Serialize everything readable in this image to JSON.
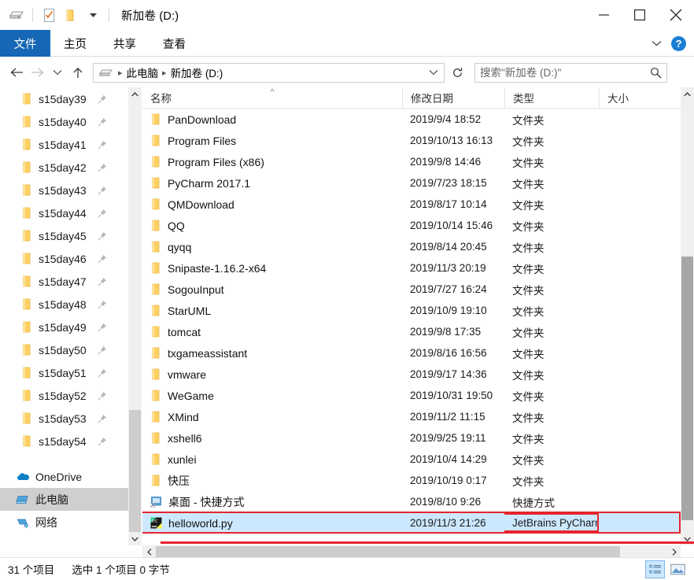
{
  "window": {
    "title": "新加卷 (D:)",
    "quick_access": [
      {
        "name": "drive-icon",
        "label": "此电脑"
      },
      {
        "name": "properties-icon",
        "label": "属性"
      },
      {
        "name": "new-folder-icon",
        "label": "新建文件夹"
      },
      {
        "name": "customize-qat-icon",
        "label": "自定义快速访问工具栏"
      }
    ],
    "controls": {
      "minimize": "最小化",
      "maximize": "最大化",
      "close": "关闭"
    }
  },
  "ribbon": {
    "tabs": [
      {
        "label": "文件",
        "active": true
      },
      {
        "label": "主页",
        "active": false
      },
      {
        "label": "共享",
        "active": false
      },
      {
        "label": "查看",
        "active": false
      }
    ],
    "collapse_label": "展开功能区",
    "help_label": "?"
  },
  "nav": {
    "back": "后退",
    "forward": "前进",
    "recent": "最近浏览的位置",
    "up": "上移一级",
    "refresh": "刷新",
    "breadcrumbs": [
      "此电脑",
      "新加卷 (D:)"
    ]
  },
  "search": {
    "placeholder": "搜索\"新加卷 (D:)\"",
    "value": ""
  },
  "sidebar": {
    "items": [
      {
        "label": "s15day39",
        "icon": "folder-icon",
        "pinned": true,
        "selected": false
      },
      {
        "label": "s15day40",
        "icon": "folder-icon",
        "pinned": true,
        "selected": false
      },
      {
        "label": "s15day41",
        "icon": "folder-icon",
        "pinned": true,
        "selected": false
      },
      {
        "label": "s15day42",
        "icon": "folder-icon",
        "pinned": true,
        "selected": false
      },
      {
        "label": "s15day43",
        "icon": "folder-icon",
        "pinned": true,
        "selected": false
      },
      {
        "label": "s15day44",
        "icon": "folder-icon",
        "pinned": true,
        "selected": false
      },
      {
        "label": "s15day45",
        "icon": "folder-icon",
        "pinned": true,
        "selected": false
      },
      {
        "label": "s15day46",
        "icon": "folder-icon",
        "pinned": true,
        "selected": false
      },
      {
        "label": "s15day47",
        "icon": "folder-icon",
        "pinned": true,
        "selected": false
      },
      {
        "label": "s15day48",
        "icon": "folder-icon",
        "pinned": true,
        "selected": false
      },
      {
        "label": "s15day49",
        "icon": "folder-icon",
        "pinned": true,
        "selected": false
      },
      {
        "label": "s15day50",
        "icon": "folder-icon",
        "pinned": true,
        "selected": false
      },
      {
        "label": "s15day51",
        "icon": "folder-icon",
        "pinned": true,
        "selected": false
      },
      {
        "label": "s15day52",
        "icon": "folder-icon",
        "pinned": true,
        "selected": false
      },
      {
        "label": "s15day53",
        "icon": "folder-icon",
        "pinned": true,
        "selected": false
      },
      {
        "label": "s15day54",
        "icon": "folder-icon",
        "pinned": true,
        "selected": false
      }
    ],
    "roots": [
      {
        "label": "OneDrive",
        "icon": "onedrive-icon",
        "selected": false
      },
      {
        "label": "此电脑",
        "icon": "this-pc-icon",
        "selected": true
      },
      {
        "label": "网络",
        "icon": "network-icon",
        "selected": false
      }
    ]
  },
  "filelist": {
    "columns": [
      {
        "key": "name",
        "label": "名称",
        "sorted": "asc"
      },
      {
        "key": "date",
        "label": "修改日期",
        "sorted": ""
      },
      {
        "key": "type",
        "label": "类型",
        "sorted": ""
      },
      {
        "key": "size",
        "label": "大小",
        "sorted": ""
      }
    ],
    "rows": [
      {
        "name": "PanDownload",
        "date": "2019/9/4 18:52",
        "type": "文件夹",
        "size": "",
        "icon": "folder-icon",
        "selected": false
      },
      {
        "name": "Program Files",
        "date": "2019/10/13 16:13",
        "type": "文件夹",
        "size": "",
        "icon": "folder-icon",
        "selected": false
      },
      {
        "name": "Program Files (x86)",
        "date": "2019/9/8 14:46",
        "type": "文件夹",
        "size": "",
        "icon": "folder-icon",
        "selected": false
      },
      {
        "name": "PyCharm 2017.1",
        "date": "2019/7/23 18:15",
        "type": "文件夹",
        "size": "",
        "icon": "folder-icon",
        "selected": false
      },
      {
        "name": "QMDownload",
        "date": "2019/8/17 10:14",
        "type": "文件夹",
        "size": "",
        "icon": "folder-icon",
        "selected": false
      },
      {
        "name": "QQ",
        "date": "2019/10/14 15:46",
        "type": "文件夹",
        "size": "",
        "icon": "folder-icon",
        "selected": false
      },
      {
        "name": "qyqq",
        "date": "2019/8/14 20:45",
        "type": "文件夹",
        "size": "",
        "icon": "folder-icon",
        "selected": false
      },
      {
        "name": "Snipaste-1.16.2-x64",
        "date": "2019/11/3 20:19",
        "type": "文件夹",
        "size": "",
        "icon": "folder-icon",
        "selected": false
      },
      {
        "name": "SogouInput",
        "date": "2019/7/27 16:24",
        "type": "文件夹",
        "size": "",
        "icon": "folder-icon",
        "selected": false
      },
      {
        "name": "StarUML",
        "date": "2019/10/9 19:10",
        "type": "文件夹",
        "size": "",
        "icon": "folder-icon",
        "selected": false
      },
      {
        "name": "tomcat",
        "date": "2019/9/8 17:35",
        "type": "文件夹",
        "size": "",
        "icon": "folder-icon",
        "selected": false
      },
      {
        "name": "txgameassistant",
        "date": "2019/8/16 16:56",
        "type": "文件夹",
        "size": "",
        "icon": "folder-icon",
        "selected": false
      },
      {
        "name": "vmware",
        "date": "2019/9/17 14:36",
        "type": "文件夹",
        "size": "",
        "icon": "folder-icon",
        "selected": false
      },
      {
        "name": "WeGame",
        "date": "2019/10/31 19:50",
        "type": "文件夹",
        "size": "",
        "icon": "folder-icon",
        "selected": false
      },
      {
        "name": "XMind",
        "date": "2019/11/2 11:15",
        "type": "文件夹",
        "size": "",
        "icon": "folder-icon",
        "selected": false
      },
      {
        "name": "xshell6",
        "date": "2019/9/25 19:11",
        "type": "文件夹",
        "size": "",
        "icon": "folder-icon",
        "selected": false
      },
      {
        "name": "xunlei",
        "date": "2019/10/4 14:29",
        "type": "文件夹",
        "size": "",
        "icon": "folder-icon",
        "selected": false
      },
      {
        "name": "快压",
        "date": "2019/10/19 0:17",
        "type": "文件夹",
        "size": "",
        "icon": "folder-icon",
        "selected": false
      },
      {
        "name": "桌面 - 快捷方式",
        "date": "2019/8/10 9:26",
        "type": "快捷方式",
        "size": "",
        "icon": "shortcut-icon",
        "selected": false
      },
      {
        "name": "helloworld.py",
        "date": "2019/11/3 21:26",
        "type": "JetBrains PyCharm",
        "size": "",
        "icon": "pycharm-file-icon",
        "selected": true
      }
    ]
  },
  "annotations": {
    "highlight_color": "#e8232e",
    "highlighted_row": "helloworld.py",
    "highlighted_cell": "JetBrains PyCharm"
  },
  "statusbar": {
    "item_count": "31 个项目",
    "selection": "选中 1 个项目  0 字节",
    "views": [
      {
        "name": "details-view-button",
        "label": "详细信息",
        "active": true
      },
      {
        "name": "large-icons-view-button",
        "label": "大图标",
        "active": false
      }
    ]
  }
}
